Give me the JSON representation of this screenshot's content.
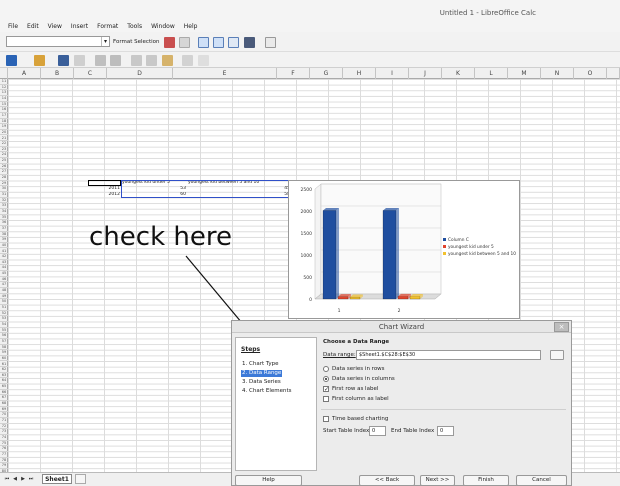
{
  "window": {
    "title": "Untitled 1 - LibreOffice Calc"
  },
  "menubar": [
    "File",
    "Edit",
    "View",
    "Insert",
    "Format",
    "Tools",
    "Window",
    "Help"
  ],
  "toolbar": {
    "format_selection_label": "Format Selection"
  },
  "columns": [
    "A",
    "B",
    "C",
    "D",
    "E",
    "F",
    "G",
    "H",
    "I",
    "J",
    "K",
    "L",
    "M",
    "N",
    "O"
  ],
  "rows": [
    "11",
    "12",
    "13",
    "14",
    "15",
    "16",
    "17",
    "18",
    "19",
    "20",
    "21",
    "22",
    "23",
    "24",
    "25",
    "26",
    "27",
    "28",
    "29",
    "30",
    "31",
    "32",
    "33",
    "34",
    "35",
    "36",
    "37",
    "38",
    "39",
    "40",
    "41",
    "42",
    "43",
    "44",
    "45",
    "46",
    "47",
    "48",
    "49",
    "50",
    "51",
    "52",
    "53",
    "54",
    "55",
    "56",
    "57",
    "58",
    "59",
    "60",
    "61",
    "62",
    "63",
    "64",
    "65",
    "66",
    "67",
    "68",
    "69",
    "70",
    "71",
    "72",
    "73",
    "74",
    "75",
    "76",
    "77",
    "78",
    "79",
    "80"
  ],
  "cells": {
    "d28": "youngest kid under 5",
    "e28": "youngest kid between 5 and 10",
    "c29": "2011",
    "d29": "53",
    "e29": "45",
    "c30": "2012",
    "d30": "60",
    "e30": "58"
  },
  "sheet": {
    "tab": "Sheet1"
  },
  "annotation": {
    "text": "check here"
  },
  "chart_data": {
    "type": "bar",
    "categories": [
      "1",
      "2"
    ],
    "series": [
      {
        "name": "Column C",
        "values": [
          2011,
          2012
        ],
        "color": "#1f4e9f"
      },
      {
        "name": "youngest kid under 5",
        "values": [
          53,
          60
        ],
        "color": "#e0442c"
      },
      {
        "name": "youngest kid between 5 and 10",
        "values": [
          45,
          58
        ],
        "color": "#f2c12e"
      }
    ],
    "ylim": [
      0,
      2500
    ],
    "yticks": [
      0,
      500,
      1000,
      1500,
      2000,
      2500
    ],
    "grid": true,
    "legend": "right"
  },
  "wizard": {
    "title": "Chart Wizard",
    "steps_title": "Steps",
    "steps": [
      "1. Chart Type",
      "2. Data Range",
      "3. Data Series",
      "4. Chart Elements"
    ],
    "active_step": 1,
    "section_title": "Choose a Data Range",
    "data_range_label": "Data range:",
    "data_range_value": "$Sheet1.$C$28:$E$30",
    "rows_label": "Data series in rows",
    "columns_label": "Data series in columns",
    "first_row_label": "First row as label",
    "first_col_label": "First column as label",
    "time_based_label": "Time based charting",
    "start_index_label": "Start Table Index",
    "start_index_value": "0",
    "end_index_label": "End Table Index",
    "end_index_value": "0",
    "help_btn": "Help",
    "back_btn": "<< Back",
    "next_btn": "Next >>",
    "finish_btn": "Finish",
    "cancel_btn": "Cancel"
  },
  "colors": {
    "accent": "#3d7ad8",
    "toolbar_bg": "#f2f2f2"
  }
}
